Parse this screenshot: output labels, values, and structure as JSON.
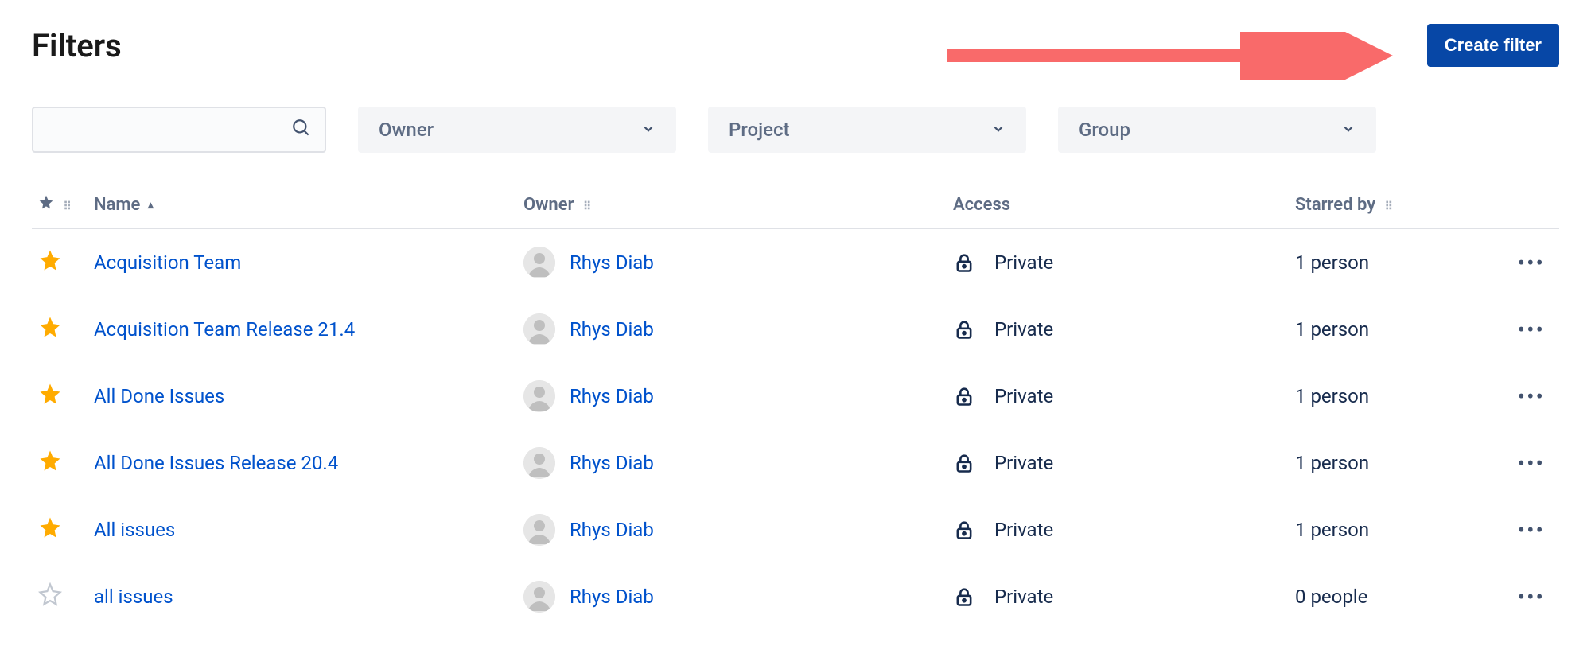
{
  "page": {
    "title": "Filters",
    "create_button": "Create filter"
  },
  "filters_bar": {
    "owner_label": "Owner",
    "project_label": "Project",
    "group_label": "Group",
    "search_placeholder": ""
  },
  "table": {
    "headers": {
      "name": "Name",
      "owner": "Owner",
      "access": "Access",
      "starred_by": "Starred by"
    },
    "rows": [
      {
        "starred": true,
        "name": "Acquisition Team",
        "owner": "Rhys Diab",
        "access": "Private",
        "starred_by": "1 person"
      },
      {
        "starred": true,
        "name": "Acquisition Team Release 21.4",
        "owner": "Rhys Diab",
        "access": "Private",
        "starred_by": "1 person"
      },
      {
        "starred": true,
        "name": "All Done Issues",
        "owner": "Rhys Diab",
        "access": "Private",
        "starred_by": "1 person"
      },
      {
        "starred": true,
        "name": "All Done Issues Release 20.4",
        "owner": "Rhys Diab",
        "access": "Private",
        "starred_by": "1 person"
      },
      {
        "starred": true,
        "name": "All issues",
        "owner": "Rhys Diab",
        "access": "Private",
        "starred_by": "1 person"
      },
      {
        "starred": false,
        "name": "all issues",
        "owner": "Rhys Diab",
        "access": "Private",
        "starred_by": "0 people"
      }
    ]
  }
}
